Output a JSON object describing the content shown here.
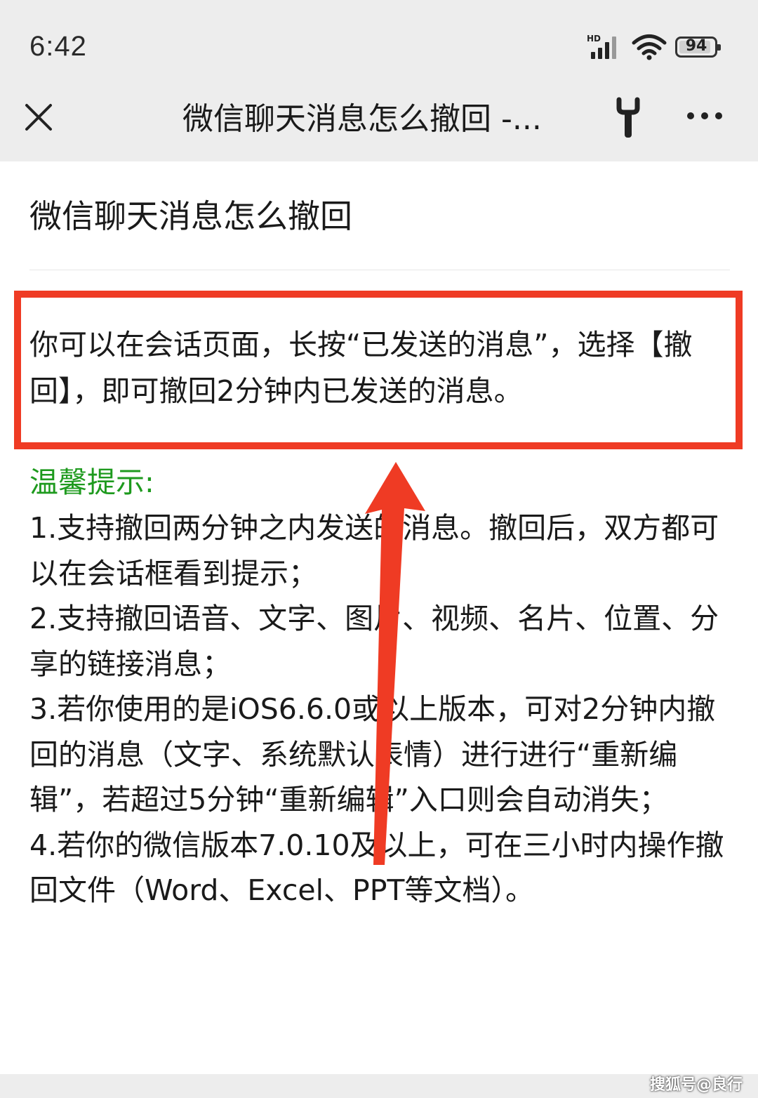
{
  "status_bar": {
    "time": "6:42",
    "network_label": "HD",
    "battery_level": "94"
  },
  "nav_bar": {
    "title": "微信聊天消息怎么撤回 -...",
    "close_icon": "close-icon",
    "tool_icon": "wrench-icon",
    "more_icon": "more-icon"
  },
  "article": {
    "title": "微信聊天消息怎么撤回",
    "answer": "你可以在会话页面，长按“已发送的消息”，选择【撤回】，即可撤回2分钟内已发送的消息。",
    "tips_heading": "温馨提示:",
    "tips": [
      "1.支持撤回两分钟之内发送的消息。撤回后，双方都可以在会话框看到提示；",
      "2.支持撤回语音、文字、图片、视频、名片、位置、分享的链接消息；",
      "3.若你使用的是iOS6.6.0或以上版本，可对2分钟内撤回的消息（文字、系统默认表情）进行进行“重新编辑”，若超过5分钟“重新编辑”入口则会自动消失；",
      "4.若你的微信版本7.0.10及以上，可在三小时内操作撤回文件（Word、Excel、PPT等文档）。"
    ]
  },
  "annotation": {
    "box_color": "#ef3b24",
    "arrow_color": "#ef3b24"
  },
  "colors": {
    "tips_heading": "#1e9a1e",
    "bar_background": "#ededed"
  },
  "watermark": "搜狐号@良行"
}
